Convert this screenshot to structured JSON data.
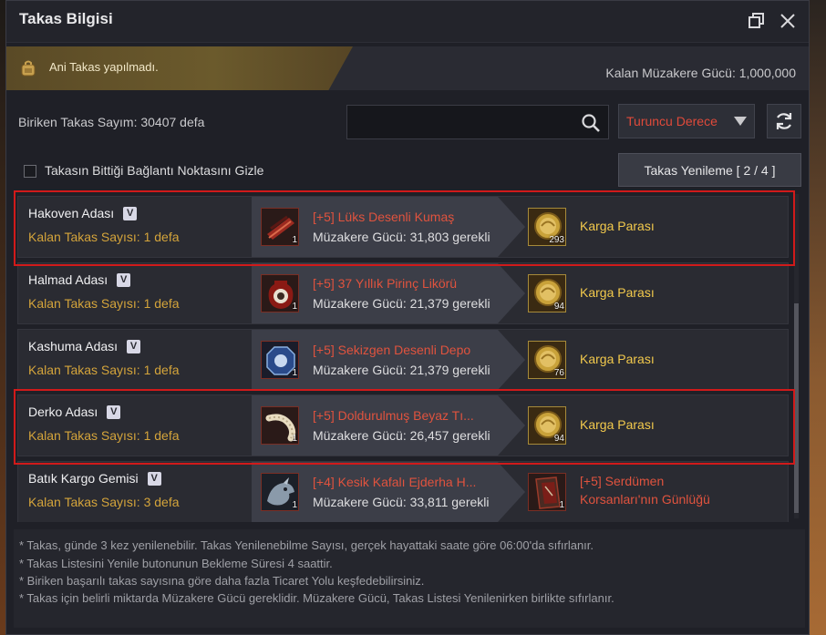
{
  "window": {
    "title": "Takas Bilgisi",
    "restore_icon": "restore-window-icon",
    "close_icon": "close-icon"
  },
  "notice": {
    "text": "Ani Takas yapılmadı.",
    "icon": "backpack-icon"
  },
  "negotiation_power": "Kalan Müzakere Gücü: 1,000,000",
  "accumulated_count": "Biriken Takas Sayım: 30407 defa",
  "search": {
    "value": "",
    "placeholder": ""
  },
  "grade_select": {
    "value": "Turuncu Derece",
    "color": "#e04a3a"
  },
  "hide_finished": {
    "label": "Takasın Bittiği Bağlantı Noktasını Gizle",
    "checked": false
  },
  "renew_button": "Takas Yenileme [ 2 / 4 ]",
  "trades": [
    {
      "location": "Hakoven Adası",
      "remaining": "Kalan Takas Sayısı: 1 defa",
      "item": "[+5] Lüks Desenli Kumaş",
      "item_qty": "1",
      "requirement": "Müzakere Gücü: 31,803 gerekli",
      "reward": "Karga Parası",
      "reward_qty": "293",
      "highlighted": true
    },
    {
      "location": "Halmad Adası",
      "remaining": "Kalan Takas Sayısı: 1 defa",
      "item": "[+5] 37 Yıllık Pirinç Likörü",
      "item_qty": "1",
      "requirement": "Müzakere Gücü: 21,379 gerekli",
      "reward": "Karga Parası",
      "reward_qty": "94",
      "highlighted": false
    },
    {
      "location": "Kashuma Adası",
      "remaining": "Kalan Takas Sayısı: 1 defa",
      "item": "[+5] Sekizgen Desenli Depo",
      "item_qty": "1",
      "requirement": "Müzakere Gücü: 21,379 gerekli",
      "reward": "Karga Parası",
      "reward_qty": "76",
      "highlighted": false
    },
    {
      "location": "Derko Adası",
      "remaining": "Kalan Takas Sayısı: 1 defa",
      "item": "[+5] Doldurulmuş Beyaz Tı...",
      "item_qty": "1",
      "requirement": "Müzakere Gücü: 26,457 gerekli",
      "reward": "Karga Parası",
      "reward_qty": "94",
      "highlighted": true
    },
    {
      "location": "Batık Kargo Gemisi",
      "remaining": "Kalan Takas Sayısı: 3 defa",
      "item": "[+4] Kesik Kafalı Ejderha H...",
      "item_qty": "1",
      "requirement": "Müzakere Gücü: 33,811 gerekli",
      "reward_line1": "[+5] Serdümen",
      "reward_line2": "Korsanları'nın Günlüğü",
      "reward_qty": "1",
      "highlighted": false
    }
  ],
  "footer_notes": [
    "* Takas, günde 3 kez yenilenebilir. Takas Yenilenebilme Sayısı, gerçek hayattaki saate göre 06:00'da sıfırlanır.",
    "* Takas Listesini Yenile butonunun Bekleme Süresi 4 saattir.",
    "* Biriken başarılı takas sayısına göre daha fazla Ticaret Yolu keşfedebilirsiniz.",
    "* Takas için belirli miktarda Müzakere Gücü gereklidir. Müzakere Gücü, Takas Listesi Yenilenirken birlikte sıfırlanır."
  ],
  "colors": {
    "highlight_border": "#d11a1a",
    "remaining_text": "#d4a43b",
    "item_name": "#e0533e",
    "reward_name": "#f2c94c"
  }
}
